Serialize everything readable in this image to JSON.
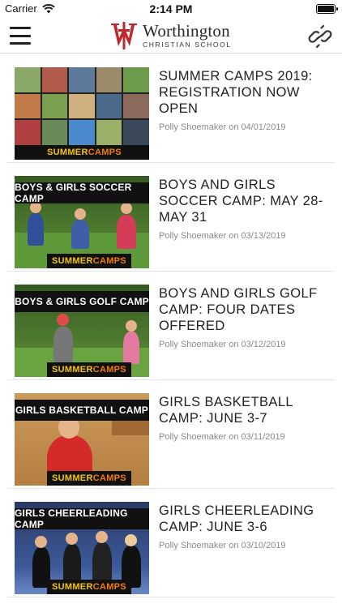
{
  "status_bar": {
    "carrier": "Carrier",
    "time": "2:14 PM"
  },
  "header": {
    "logo_name": "Worthington",
    "logo_sub": "CHRISTIAN SCHOOL",
    "brand_color": "#c0272d"
  },
  "posts": [
    {
      "title": "SUMMER CAMPS 2019: REGISTRATION NOW OPEN",
      "meta": "Polly Shoemaker on 04/01/2019",
      "thumb_banner": "",
      "thumb_footer_a": "SUMMER",
      "thumb_footer_b": "CAMPS"
    },
    {
      "title": "BOYS AND GIRLS SOCCER CAMP:  MAY 28-MAY 31",
      "meta": "Polly Shoemaker on 03/13/2019",
      "thumb_banner": "BOYS & GIRLS SOCCER CAMP",
      "thumb_footer_a": "SUMMER",
      "thumb_footer_b": "CAMPS"
    },
    {
      "title": "BOYS AND GIRLS GOLF CAMP:  FOUR DATES OFFERED",
      "meta": "Polly Shoemaker on 03/12/2019",
      "thumb_banner": "BOYS & GIRLS GOLF CAMP",
      "thumb_footer_a": "SUMMER",
      "thumb_footer_b": "CAMPS"
    },
    {
      "title": "GIRLS BASKETBALL CAMP: JUNE 3-7",
      "meta": "Polly Shoemaker on 03/11/2019",
      "thumb_banner": "GIRLS BASKETBALL CAMP",
      "thumb_footer_a": "SUMMER",
      "thumb_footer_b": "CAMPS"
    },
    {
      "title": "GIRLS CHEERLEADING CAMP: JUNE 3-6",
      "meta": "Polly Shoemaker on 03/10/2019",
      "thumb_banner": "GIRLS CHEERLEADING CAMP",
      "thumb_footer_a": "SUMMER",
      "thumb_footer_b": "CAMPS"
    }
  ],
  "icons": {
    "menu": "hamburger-menu-icon",
    "link": "chain-link-icon",
    "wifi": "wifi-icon",
    "battery": "battery-icon"
  }
}
